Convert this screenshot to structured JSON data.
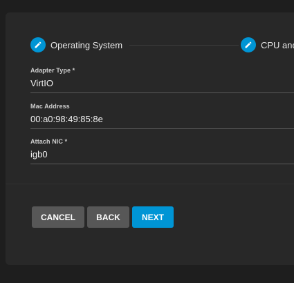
{
  "stepper": {
    "steps": [
      {
        "label": "Operating System",
        "icon": "pencil-icon"
      },
      {
        "label": "CPU and",
        "icon": "pencil-icon"
      }
    ],
    "accent_color": "#0095d5"
  },
  "form": {
    "adapter_type": {
      "label": "Adapter Type *",
      "value": "VirtIO"
    },
    "mac_address": {
      "label": "Mac Address",
      "value": "00:a0:98:49:85:8e"
    },
    "attach_nic": {
      "label": "Attach NIC *",
      "value": "igb0"
    }
  },
  "actions": {
    "cancel_label": "CANCEL",
    "back_label": "BACK",
    "next_label": "NEXT"
  }
}
